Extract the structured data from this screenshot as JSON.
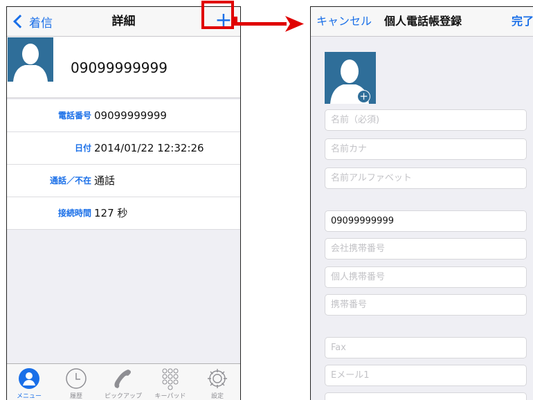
{
  "left_screen": {
    "nav": {
      "back_label": "着信",
      "title": "詳細",
      "add_symbol": "+"
    },
    "contact": {
      "number": "09099999999"
    },
    "details": [
      {
        "label": "電話番号",
        "value": "09099999999"
      },
      {
        "label": "日付",
        "value": "2014/01/22 12:32:26"
      },
      {
        "label": "通話／不在",
        "value": "通話"
      },
      {
        "label": "接続時間",
        "value": "127 秒"
      }
    ],
    "tabbar": {
      "tabs": [
        {
          "label": "メニュー",
          "icon": "person-circle-icon",
          "active": true
        },
        {
          "label": "履歴",
          "icon": "clock-icon"
        },
        {
          "label": "ピックアップ",
          "icon": "handset-icon"
        },
        {
          "label": "キーパッド",
          "icon": "keypad-icon"
        },
        {
          "label": "設定",
          "icon": "gear-icon"
        }
      ]
    }
  },
  "right_screen": {
    "nav": {
      "cancel_label": "キャンセル",
      "title": "個人電話帳登録",
      "done_label": "完了"
    },
    "fields": {
      "name_placeholder": "名前（必須)",
      "name_kana_placeholder": "名前カナ",
      "name_alpha_placeholder": "名前アルファベット",
      "phone_value": "09099999999",
      "company_mobile_placeholder": "会社携帯番号",
      "personal_mobile_placeholder": "個人携帯番号",
      "mobile_placeholder": "携帯番号",
      "fax_placeholder": "Fax",
      "email1_placeholder": "Eメール1"
    }
  },
  "colors": {
    "accent": "#1a6fe8",
    "annotation": "#e00000",
    "avatar": "#2f6e99"
  }
}
